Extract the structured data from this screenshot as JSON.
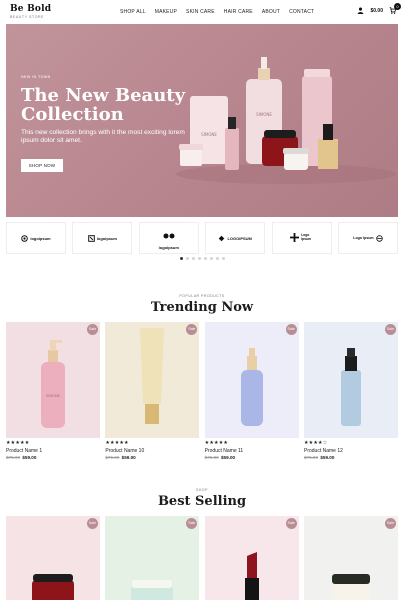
{
  "brand": {
    "name": "Be Bold",
    "tagline": "BEAUTY STORE"
  },
  "nav": [
    "SHOP ALL",
    "MAKEUP",
    "SKIN CARE",
    "HAIR CARE",
    "ABOUT",
    "CONTACT"
  ],
  "header": {
    "cart_total": "$0.00",
    "cart_count": "0",
    "user_icon": "user-icon",
    "cart_icon": "cart-icon"
  },
  "hero": {
    "eyebrow": "NEW IN TOWN",
    "title": "The New Beauty Collection",
    "description": "This new collection brings with it the most exciting lorem ipsum dolor sit amet.",
    "button": "SHOP NOW",
    "background": "#b98790"
  },
  "logos": [
    "logoipsum",
    "logoipsum",
    "logoipsum",
    "LOGOIPSUM",
    "Logo Ipsum",
    "Logo Ipsum"
  ],
  "carousel": {
    "total": 8,
    "active": 0
  },
  "trending": {
    "eyebrow": "POPULAR PRODUCTS",
    "title": "Trending Now",
    "products": [
      {
        "name": "Product Name 1",
        "stars": "★★★★★",
        "old_price": "$75.00",
        "price": "$59.00",
        "badge": "Sale",
        "bg": "#f2dfe3",
        "product": "pump-bottle-pink"
      },
      {
        "name": "Product Name 10",
        "stars": "★★★★★",
        "old_price": "$75.00",
        "price": "$59.00",
        "badge": "Sale",
        "bg": "#f1ead8",
        "product": "tube-cream"
      },
      {
        "name": "Product Name 11",
        "stars": "★★★★★",
        "old_price": "$75.00",
        "price": "$59.00",
        "badge": "Sale",
        "bg": "#ecedf8",
        "product": "bottle-lavender"
      },
      {
        "name": "Product Name 12",
        "stars": "★★★★☆",
        "old_price": "$75.00",
        "price": "$59.00",
        "badge": "Sale",
        "bg": "#e9eef6",
        "product": "dropper-blue"
      }
    ]
  },
  "bestselling": {
    "eyebrow": "SHOP",
    "title": "Best Selling",
    "products": [
      {
        "badge": "Sale",
        "bg": "#f6e3e6",
        "product": "jar-red"
      },
      {
        "badge": "Sale",
        "bg": "#e6f1e6",
        "product": "jar-mint"
      },
      {
        "badge": "Sale",
        "bg": "#f7e6ea",
        "product": "lipstick-red"
      },
      {
        "badge": "Sale",
        "bg": "#f1f1ef",
        "product": "jar-dark"
      }
    ]
  }
}
